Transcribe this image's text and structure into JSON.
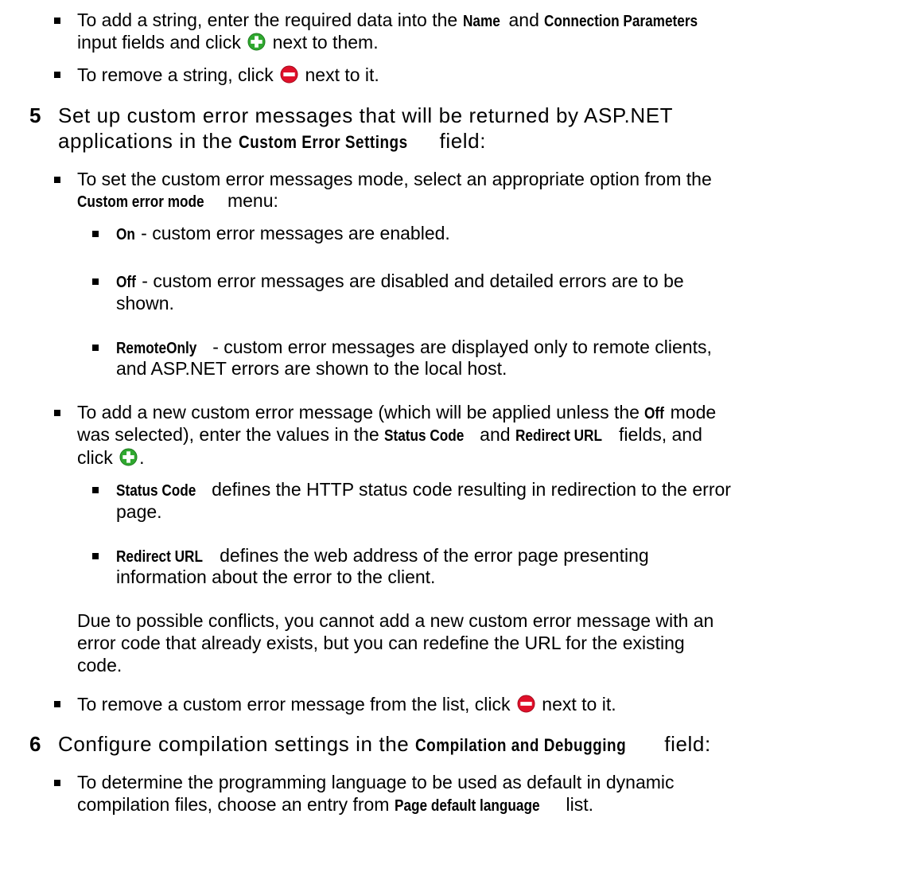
{
  "colors": {
    "add_icon": "#2fa82f",
    "remove_icon": "#e0102a"
  },
  "icons": {
    "add": "plus-circle-icon",
    "remove": "minus-circle-icon"
  },
  "connection_strings": {
    "add_a": "To add a string, enter the required data into the ",
    "add_name": "Name",
    "add_and": " and ",
    "add_params": "Connection Parameters",
    "add_b": "input fields and click ",
    "add_c": " next to them.",
    "remove_a": "To remove a string, click ",
    "remove_b": " next to it."
  },
  "step5": {
    "number": "5",
    "line1": "Set up custom error messages that will be returned by ASP.NET",
    "line2_a": "applications in the ",
    "line2_field": "Custom Error Settings",
    "line2_b": " field:",
    "mode_a": "To set the custom error messages mode, select an appropriate option from the",
    "mode_menu": "Custom error mode",
    "mode_b": " menu:",
    "on_label": "On",
    "on_text": " - custom error messages are enabled.",
    "off_label": "Off",
    "off_text1": " - custom error messages are disabled and detailed errors are to be",
    "off_text2": "shown.",
    "remote_label": "RemoteOnly",
    "remote_text1": " - custom error messages are displayed only to remote clients,",
    "remote_text2": "and ASP.NET errors are shown to the local host.",
    "addmsg_a": "To add a new custom error message (which will be applied unless the ",
    "addmsg_off": "Off",
    "addmsg_b": " mode",
    "addmsg_c": "was selected), enter the values in the ",
    "addmsg_status": "Status Code",
    "addmsg_d": " and ",
    "addmsg_redirect": "Redirect URL",
    "addmsg_e": " fields, and",
    "addmsg_f": "click ",
    "addmsg_g": ".",
    "status_label": "Status Code",
    "status_text1": " defines the HTTP status code resulting in redirection to the error",
    "status_text2": "page.",
    "redirect_label": "Redirect URL",
    "redirect_text1": " defines the web address of the error page presenting",
    "redirect_text2": "information about the error to the client.",
    "note1": "Due to possible conflicts, you cannot add a new custom error message with an",
    "note2": "error code that already exists, but you can redefine the URL for the existing",
    "note3": "code.",
    "remove_a": "To remove a custom error message from the list, click ",
    "remove_b": " next to it."
  },
  "step6": {
    "number": "6",
    "line1_a": "Configure compilation settings in the ",
    "line1_field": "Compilation and Debugging",
    "line1_b": " field:",
    "lang_a": "To determine the programming language to be used as default in dynamic",
    "lang_b": "compilation files, choose an entry from ",
    "lang_field": "Page default language",
    "lang_c": " list."
  }
}
